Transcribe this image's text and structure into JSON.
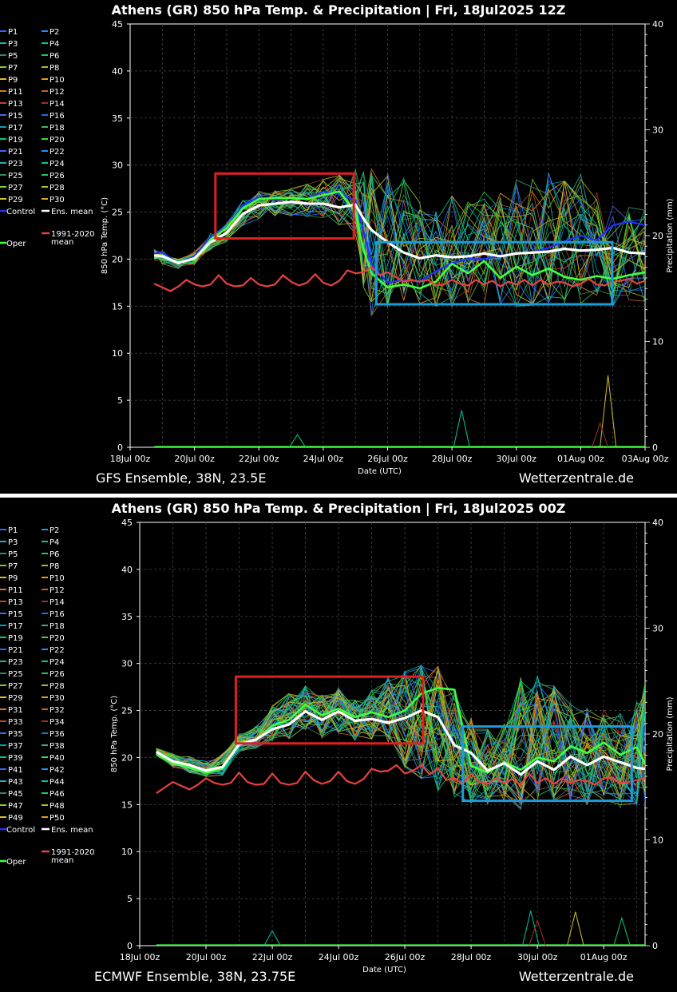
{
  "panels": [
    {
      "title": "Athens  (GR)  850 hPa Temp. & Precipitation | Fri, 18Jul2025 12Z",
      "model_label": "GFS Ensemble, 38N, 23.5E",
      "site_label": "Wetterzentrale.de",
      "members": [
        "P1",
        "P2",
        "P3",
        "P4",
        "P5",
        "P6",
        "P7",
        "P8",
        "P9",
        "P10",
        "P11",
        "P12",
        "P13",
        "P14",
        "P15",
        "P16",
        "P17",
        "P18",
        "P19",
        "P20",
        "P21",
        "P22",
        "P23",
        "P24",
        "P25",
        "P26",
        "P27",
        "P28",
        "P29",
        "P30"
      ],
      "control_label": "Control",
      "ens_mean_label": "Ens. mean",
      "clim_label": "1991-2020",
      "clim_label2": "mean",
      "oper_label": "Oper",
      "highlight_boxes": [
        {
          "color": "#e02020",
          "t0": 2.65,
          "t1": 6.95,
          "v0": 22.2,
          "v1": 29.1
        },
        {
          "color": "#1e9bd7",
          "t0": 7.65,
          "t1": 14.98,
          "v0": 15.2,
          "v1": 21.8
        }
      ]
    },
    {
      "title": "Athens  (GR)  850 hPa Temp. & Precipitation | Fri, 18Jul2025 00Z",
      "model_label": "ECMWF Ensemble, 38N, 23.75E",
      "site_label": "Wetterzentrale.de",
      "members": [
        "P1",
        "P2",
        "P3",
        "P4",
        "P5",
        "P6",
        "P7",
        "P8",
        "P9",
        "P10",
        "P11",
        "P12",
        "P13",
        "P14",
        "P15",
        "P16",
        "P17",
        "P18",
        "P19",
        "P20",
        "P21",
        "P22",
        "P23",
        "P24",
        "P25",
        "P26",
        "P27",
        "P28",
        "P29",
        "P30",
        "P31",
        "P32",
        "P33",
        "P34",
        "P35",
        "P36",
        "P37",
        "P38",
        "P39",
        "P40",
        "P41",
        "P42",
        "P43",
        "P44",
        "P45",
        "P46",
        "P47",
        "P48",
        "P49",
        "P50"
      ],
      "control_label": "Control",
      "ens_mean_label": "Ens. mean",
      "clim_label": "1991-2020",
      "clim_label2": "mean",
      "oper_label": "Oper",
      "highlight_boxes": [
        {
          "color": "#e02020",
          "t0": 2.9,
          "t1": 8.55,
          "v0": 21.5,
          "v1": 28.6
        },
        {
          "color": "#1e9bd7",
          "t0": 9.75,
          "t1": 14.85,
          "v0": 15.4,
          "v1": 23.3
        }
      ]
    }
  ],
  "chart_data": [
    {
      "type": "line",
      "title": "Athens  (GR)  850 hPa Temp. & Precipitation | Fri, 18Jul2025 12Z",
      "xlabel": "Date (UTC)",
      "ylabel": "850 hPa Temp. (°C)",
      "y2label": "Precipitation (mm)",
      "x_ticks": [
        "18Jul 00z",
        "20Jul 00z",
        "22Jul 00z",
        "24Jul 00z",
        "26Jul 00z",
        "28Jul 00z",
        "30Jul 00z",
        "01Aug 00z",
        "03Aug 00z"
      ],
      "xlim_days": [
        0,
        16
      ],
      "ylim": [
        0,
        45
      ],
      "y_ticks": [
        0,
        5,
        10,
        15,
        20,
        25,
        30,
        35,
        40,
        45
      ],
      "y2lim": [
        0,
        40
      ],
      "y2_ticks": [
        0,
        10,
        20,
        30,
        40
      ],
      "grid": true,
      "legend_position": "left",
      "series": [
        {
          "name": "Ens. mean",
          "color": "#ffffff",
          "x_days": [
            0.75,
            1,
            1.5,
            2,
            2.5,
            3,
            3.5,
            4,
            4.5,
            5,
            5.5,
            6,
            6.5,
            7,
            7.25,
            7.5,
            8,
            8.5,
            9,
            9.5,
            10,
            10.5,
            11,
            11.5,
            12,
            12.5,
            13,
            13.5,
            14,
            14.5,
            15,
            15.5,
            16
          ],
          "values": [
            20.4,
            20.3,
            19.6,
            20.1,
            21.8,
            22.8,
            24.8,
            25.7,
            25.9,
            26.1,
            25.9,
            25.9,
            25.5,
            25.8,
            24.3,
            23.1,
            21.8,
            20.7,
            20.1,
            20.4,
            20.2,
            20.3,
            20.6,
            20.3,
            20.6,
            20.7,
            20.8,
            21.1,
            20.9,
            21.0,
            21.2,
            20.7,
            20.6
          ]
        },
        {
          "name": "Control",
          "color": "#2030ff",
          "x_days": [
            0.75,
            1,
            1.5,
            2,
            2.5,
            3,
            3.5,
            4,
            4.5,
            5,
            5.5,
            6,
            6.5,
            7,
            7.25,
            7.5,
            8,
            8.5,
            9,
            9.5,
            10,
            10.5,
            11,
            11.5,
            12,
            12.5,
            13,
            13.5,
            14,
            14.5,
            15,
            15.5,
            16
          ],
          "values": [
            20.6,
            20.7,
            19.6,
            20.3,
            22.4,
            23.3,
            25.7,
            26.6,
            26.3,
            26.5,
            26.4,
            27.2,
            26.9,
            26.3,
            23.0,
            19.5,
            17.5,
            17.8,
            17.6,
            18.7,
            19.6,
            20.0,
            20.0,
            20.4,
            20.6,
            20.7,
            21.2,
            21.9,
            22.5,
            22.0,
            23.6,
            24.0,
            23.6
          ]
        },
        {
          "name": "Oper",
          "color": "#40ff40",
          "x_days": [
            0.75,
            1,
            1.5,
            2,
            2.5,
            3,
            3.5,
            4,
            4.5,
            5,
            5.5,
            6,
            6.5,
            7,
            7.25,
            7.5,
            8,
            8.5,
            9,
            9.5,
            10,
            10.5,
            11,
            11.5,
            12,
            12.5,
            13,
            13.5,
            14,
            14.5,
            15,
            15.5,
            16
          ],
          "values": [
            20.1,
            20.4,
            19.6,
            20.0,
            22.1,
            23.3,
            25.4,
            26.4,
            26.5,
            26.5,
            26.4,
            26.8,
            27.2,
            25.0,
            21.0,
            18.5,
            17.0,
            17.3,
            16.9,
            17.6,
            19.5,
            18.5,
            19.8,
            18.0,
            19.2,
            18.3,
            19.0,
            18.1,
            17.8,
            18.2,
            17.9,
            18.3,
            18.6
          ]
        },
        {
          "name": "1991-2020 mean",
          "color": "#e84040",
          "x_days": [
            0.75,
            1,
            1.25,
            1.5,
            1.75,
            2,
            2.25,
            2.5,
            2.75,
            3,
            3.25,
            3.5,
            3.75,
            4,
            4.25,
            4.5,
            4.75,
            5,
            5.25,
            5.5,
            5.75,
            6,
            6.25,
            6.5,
            6.75,
            7,
            7.25,
            7.5,
            7.75,
            8,
            8.25,
            8.5,
            8.75,
            9,
            9.25,
            9.5,
            9.75,
            10,
            10.25,
            10.5,
            10.75,
            11,
            11.25,
            11.5,
            11.75,
            12,
            12.25,
            12.5,
            12.75,
            13,
            13.25,
            13.5,
            13.75,
            14,
            14.25,
            14.5,
            14.75,
            15,
            15.25,
            15.5,
            15.75,
            16
          ],
          "values": [
            17.4,
            17.0,
            16.6,
            17.1,
            17.8,
            17.3,
            17.1,
            17.3,
            18.3,
            17.4,
            17.1,
            17.2,
            18.0,
            17.3,
            17.1,
            17.3,
            18.3,
            17.6,
            17.2,
            17.5,
            18.4,
            17.5,
            17.2,
            17.7,
            18.8,
            18.5,
            18.6,
            19.2,
            18.3,
            18.6,
            18.1,
            17.6,
            17.8,
            17.6,
            17.8,
            17.2,
            17.3,
            17.8,
            17.4,
            17.2,
            17.8,
            17.3,
            17.7,
            17.1,
            17.6,
            17.3,
            17.8,
            17.2,
            17.8,
            17.3,
            17.6,
            17.5,
            17.1,
            17.4,
            17.9,
            17.3,
            17.2,
            17.6,
            17.7,
            17.9,
            17.4,
            17.7
          ]
        }
      ],
      "member_stats": {
        "x_days": [
          0.75,
          1,
          1.5,
          2,
          2.5,
          3,
          3.5,
          4,
          4.5,
          5,
          5.5,
          6,
          6.5,
          7,
          7.25,
          7.5,
          8,
          8.5,
          9,
          9.5,
          10,
          10.5,
          11,
          11.5,
          12,
          12.5,
          13,
          13.5,
          14,
          14.5,
          15,
          15.5,
          16
        ],
        "min": [
          19.8,
          19.5,
          19.0,
          19.4,
          21.0,
          21.8,
          23.6,
          24.3,
          24.6,
          24.6,
          24.4,
          24.4,
          23.5,
          22.5,
          17.0,
          14.0,
          14.8,
          15.6,
          15.3,
          15.0,
          15.0,
          15.4,
          15.1,
          15.2,
          15.0,
          15.1,
          15.4,
          15.0,
          15.2,
          15.4,
          15.0,
          15.1,
          15.3
        ],
        "max": [
          21.1,
          21.0,
          20.0,
          20.8,
          22.8,
          23.8,
          26.5,
          27.2,
          27.3,
          27.5,
          28.0,
          28.5,
          29.0,
          29.8,
          29.3,
          29.6,
          29.4,
          28.9,
          26.0,
          26.2,
          26.7,
          26.5,
          27.4,
          27.0,
          28.4,
          28.8,
          29.2,
          28.3,
          29.0,
          27.3,
          26.4,
          25.5,
          25.3
        ]
      },
      "precip_peaks_mm": [
        {
          "day": 10.3,
          "mm": 3.5
        },
        {
          "day": 14.85,
          "mm": 6.8
        },
        {
          "day": 14.6,
          "mm": 2.3
        },
        {
          "day": 5.2,
          "mm": 1.2
        }
      ]
    },
    {
      "type": "line",
      "title": "Athens  (GR)  850 hPa Temp. & Precipitation | Fri, 18Jul2025 00Z",
      "xlabel": "Date (UTC)",
      "ylabel": "850 hPa Temp. (°C)",
      "y2label": "Precipitation (mm)",
      "x_ticks": [
        "18Jul 00z",
        "20Jul 00z",
        "22Jul 00z",
        "24Jul 00z",
        "26Jul 00z",
        "28Jul 00z",
        "30Jul 00z",
        "01Aug 00z"
      ],
      "xlim_days": [
        0,
        15.25
      ],
      "ylim": [
        0,
        45
      ],
      "y_ticks": [
        0,
        5,
        10,
        15,
        20,
        25,
        30,
        35,
        40,
        45
      ],
      "y2lim": [
        0,
        40
      ],
      "y2_ticks": [
        0,
        10,
        20,
        30,
        40
      ],
      "grid": true,
      "legend_position": "left",
      "series": [
        {
          "name": "Ens. mean",
          "color": "#ffffff",
          "x_days": [
            0.5,
            1,
            1.5,
            2,
            2.5,
            3,
            3.5,
            4,
            4.5,
            5,
            5.5,
            6,
            6.5,
            7,
            7.5,
            8,
            8.5,
            9,
            9.5,
            10,
            10.5,
            11,
            11.5,
            12,
            12.5,
            13,
            13.5,
            14,
            14.5,
            15,
            15.25
          ],
          "values": [
            20.6,
            19.6,
            19.2,
            18.6,
            19.0,
            21.4,
            21.9,
            23.0,
            23.5,
            24.9,
            24.0,
            24.9,
            23.9,
            24.1,
            23.7,
            24.2,
            25.0,
            24.3,
            21.3,
            20.5,
            18.6,
            19.4,
            18.2,
            19.6,
            18.7,
            20.1,
            19.2,
            20.1,
            19.5,
            18.9,
            18.8
          ]
        },
        {
          "name": "Oper",
          "color": "#40ff40",
          "x_days": [
            0.5,
            1,
            1.5,
            2,
            2.5,
            3,
            3.5,
            4,
            4.5,
            5,
            5.5,
            6,
            6.5,
            7,
            7.5,
            8,
            8.5,
            9,
            9.5,
            10,
            10.5,
            11,
            11.5,
            12,
            12.5,
            13,
            13.5,
            14,
            14.5,
            15,
            15.25
          ],
          "values": [
            20.4,
            19.4,
            18.9,
            18.4,
            18.8,
            21.6,
            21.8,
            23.4,
            24.0,
            25.6,
            24.5,
            25.2,
            24.3,
            24.8,
            24.3,
            25.0,
            26.8,
            27.4,
            27.2,
            19.1,
            18.4,
            19.5,
            18.7,
            20.0,
            19.6,
            21.2,
            20.5,
            21.6,
            20.3,
            21.1,
            19.3
          ]
        },
        {
          "name": "1991-2020 mean",
          "color": "#e84040",
          "x_days": [
            0.5,
            0.75,
            1,
            1.25,
            1.5,
            1.75,
            2,
            2.25,
            2.5,
            2.75,
            3,
            3.25,
            3.5,
            3.75,
            4,
            4.25,
            4.5,
            4.75,
            5,
            5.25,
            5.5,
            5.75,
            6,
            6.25,
            6.5,
            6.75,
            7,
            7.25,
            7.5,
            7.75,
            8,
            8.25,
            8.5,
            8.75,
            9,
            9.25,
            9.5,
            9.75,
            10,
            10.25,
            10.5,
            10.75,
            11,
            11.25,
            11.5,
            11.75,
            12,
            12.25,
            12.5,
            12.75,
            13,
            13.25,
            13.5,
            13.75,
            14,
            14.25,
            14.5,
            14.75,
            15,
            15.25
          ],
          "values": [
            16.2,
            16.8,
            17.4,
            17.0,
            16.6,
            17.1,
            17.8,
            17.3,
            17.1,
            17.3,
            18.4,
            17.4,
            17.1,
            17.2,
            18.3,
            17.3,
            17.1,
            17.3,
            18.5,
            17.6,
            17.2,
            17.5,
            18.5,
            17.5,
            17.2,
            17.7,
            18.8,
            18.5,
            18.6,
            19.2,
            18.3,
            18.6,
            19.2,
            18.2,
            18.9,
            17.6,
            17.8,
            17.2,
            18.3,
            17.4,
            17.2,
            17.8,
            17.3,
            17.7,
            17.1,
            18.3,
            17.3,
            17.8,
            17.2,
            17.8,
            17.3,
            17.6,
            17.5,
            17.1,
            17.8,
            17.9,
            17.3,
            17.4,
            17.6,
            17.8
          ]
        }
      ],
      "member_stats": {
        "x_days": [
          0.5,
          1,
          1.5,
          2,
          2.5,
          3,
          3.5,
          4,
          4.5,
          5,
          5.5,
          6,
          6.5,
          7,
          7.5,
          8,
          8.5,
          9,
          9.5,
          10,
          10.5,
          11,
          11.5,
          12,
          12.5,
          13,
          13.5,
          14,
          14.5,
          15,
          15.25
        ],
        "min": [
          20.2,
          19.0,
          18.4,
          18.0,
          18.1,
          20.6,
          21.0,
          21.8,
          22.0,
          23.0,
          22.0,
          22.6,
          21.8,
          22.0,
          21.5,
          19.0,
          17.8,
          16.5,
          15.8,
          15.2,
          15.0,
          15.4,
          14.5,
          15.2,
          14.8,
          15.3,
          15.0,
          15.3,
          14.6,
          15.0,
          14.9
        ],
        "max": [
          21.0,
          20.4,
          20.1,
          19.6,
          20.4,
          22.5,
          23.3,
          25.5,
          26.8,
          27.6,
          26.6,
          27.4,
          26.2,
          27.2,
          28.6,
          29.2,
          29.8,
          29.7,
          26.9,
          24.2,
          23.0,
          23.6,
          28.5,
          28.7,
          27.6,
          26.0,
          25.3,
          25.4,
          25.1,
          26.0,
          27.9
        ]
      },
      "precip_peaks_mm": [
        {
          "day": 11.8,
          "mm": 3.3
        },
        {
          "day": 13.15,
          "mm": 3.2
        },
        {
          "day": 12.0,
          "mm": 2.4
        },
        {
          "day": 14.55,
          "mm": 2.6
        },
        {
          "day": 4.0,
          "mm": 1.4
        }
      ]
    }
  ]
}
